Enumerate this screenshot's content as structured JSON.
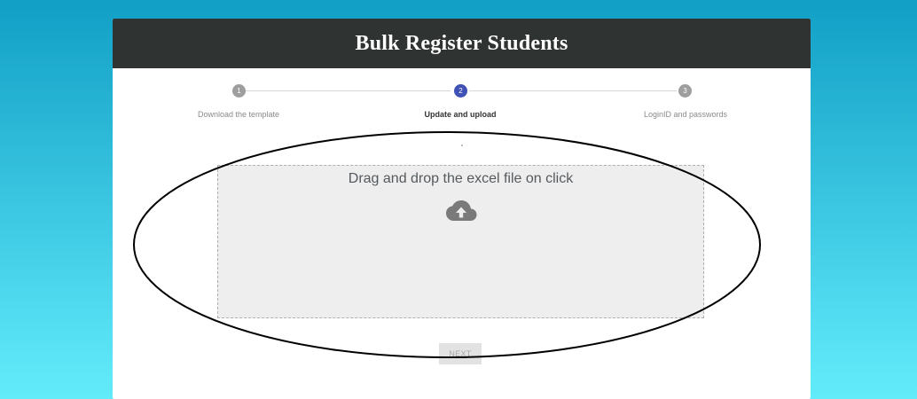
{
  "header": {
    "title": "Bulk Register Students"
  },
  "stepper": {
    "steps": [
      {
        "number": "1",
        "label": "Download the template",
        "state": "inactive"
      },
      {
        "number": "2",
        "label": "Update and upload",
        "state": "active"
      },
      {
        "number": "3",
        "label": "LoginID and passwords",
        "state": "inactive"
      }
    ]
  },
  "upload": {
    "prompt": "Drag and drop the excel file on click",
    "icon": "cloud-upload-icon"
  },
  "actions": {
    "next_label": "NEXT"
  },
  "colors": {
    "header_bg": "#2f3432",
    "active_step": "#3f51b5",
    "inactive_step": "#9e9e9e",
    "dropzone_bg": "#eeeeee"
  }
}
